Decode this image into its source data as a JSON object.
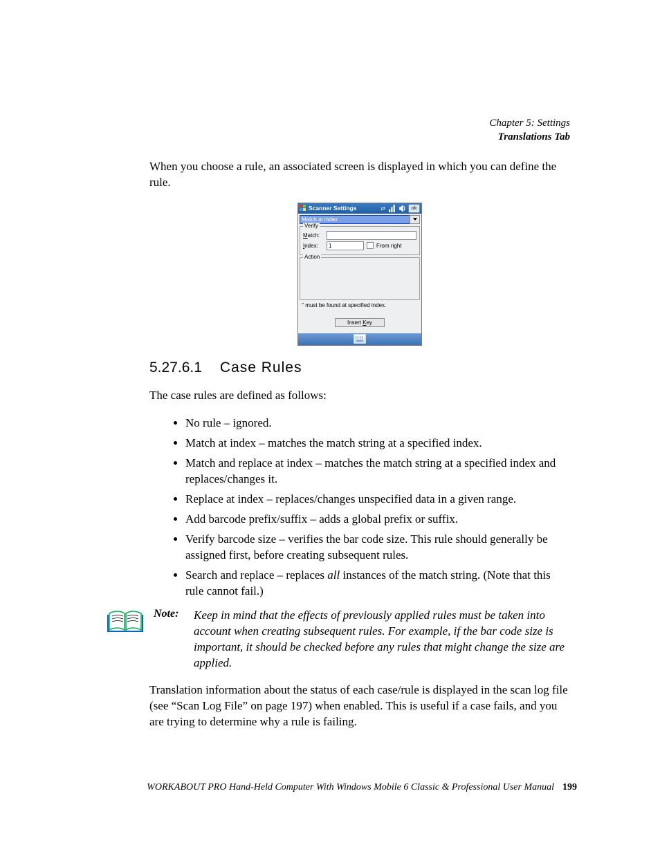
{
  "header": {
    "line1": "Chapter 5: Settings",
    "line2": "Translations Tab"
  },
  "intro": "When you choose a rule, an associated screen is displayed in which you can define the rule.",
  "screenshot": {
    "title": "Scanner Settings",
    "ok": "ok",
    "combo": "Match at index",
    "verify_legend": "Verify",
    "match_label_pre": "M",
    "match_label_rest": "atch:",
    "index_label_pre": "I",
    "index_label_rest": "ndex:",
    "index_value": "1",
    "from_right": "From right",
    "action_legend": "Action",
    "hint": "'' must be found at specified index.",
    "insert_pre": "Insert ",
    "insert_key_u": "K",
    "insert_key_rest": "ey"
  },
  "section": {
    "num": "5.27.6.1",
    "title": "Case Rules"
  },
  "listintro": "The case rules are defined as follows:",
  "rules": [
    "No rule – ignored.",
    "Match at index – matches the match string at a specified index.",
    "Match and replace at index – matches the match string at a specified index and replaces/changes it.",
    "Replace at index – replaces/changes unspecified data in a given range.",
    "Add barcode prefix/suffix – adds a global prefix or suffix.",
    "Verify barcode size – verifies the bar code size. This rule should generally be assigned first, before creating subsequent rules."
  ],
  "rule_sr_a": "Search and replace – replaces ",
  "rule_sr_i": "all",
  "rule_sr_b": " instances of the match string. (Note that this rule cannot fail.)",
  "note_label": "Note:",
  "note_body": "Keep in mind that the effects of previously applied rules must be taken into account when creating subsequent rules. For example, if the bar code size is important, it should be checked before any rules that might change the size are applied.",
  "after": "Translation information about the status of each case/rule is displayed in the scan log file (see “Scan Log File” on page 197) when enabled. This is useful if a case fails, and you are trying to determine why a rule is failing.",
  "footer": {
    "text": "WORKABOUT PRO Hand-Held Computer With Windows Mobile 6 Classic & Professional User Manual",
    "page": "199"
  }
}
